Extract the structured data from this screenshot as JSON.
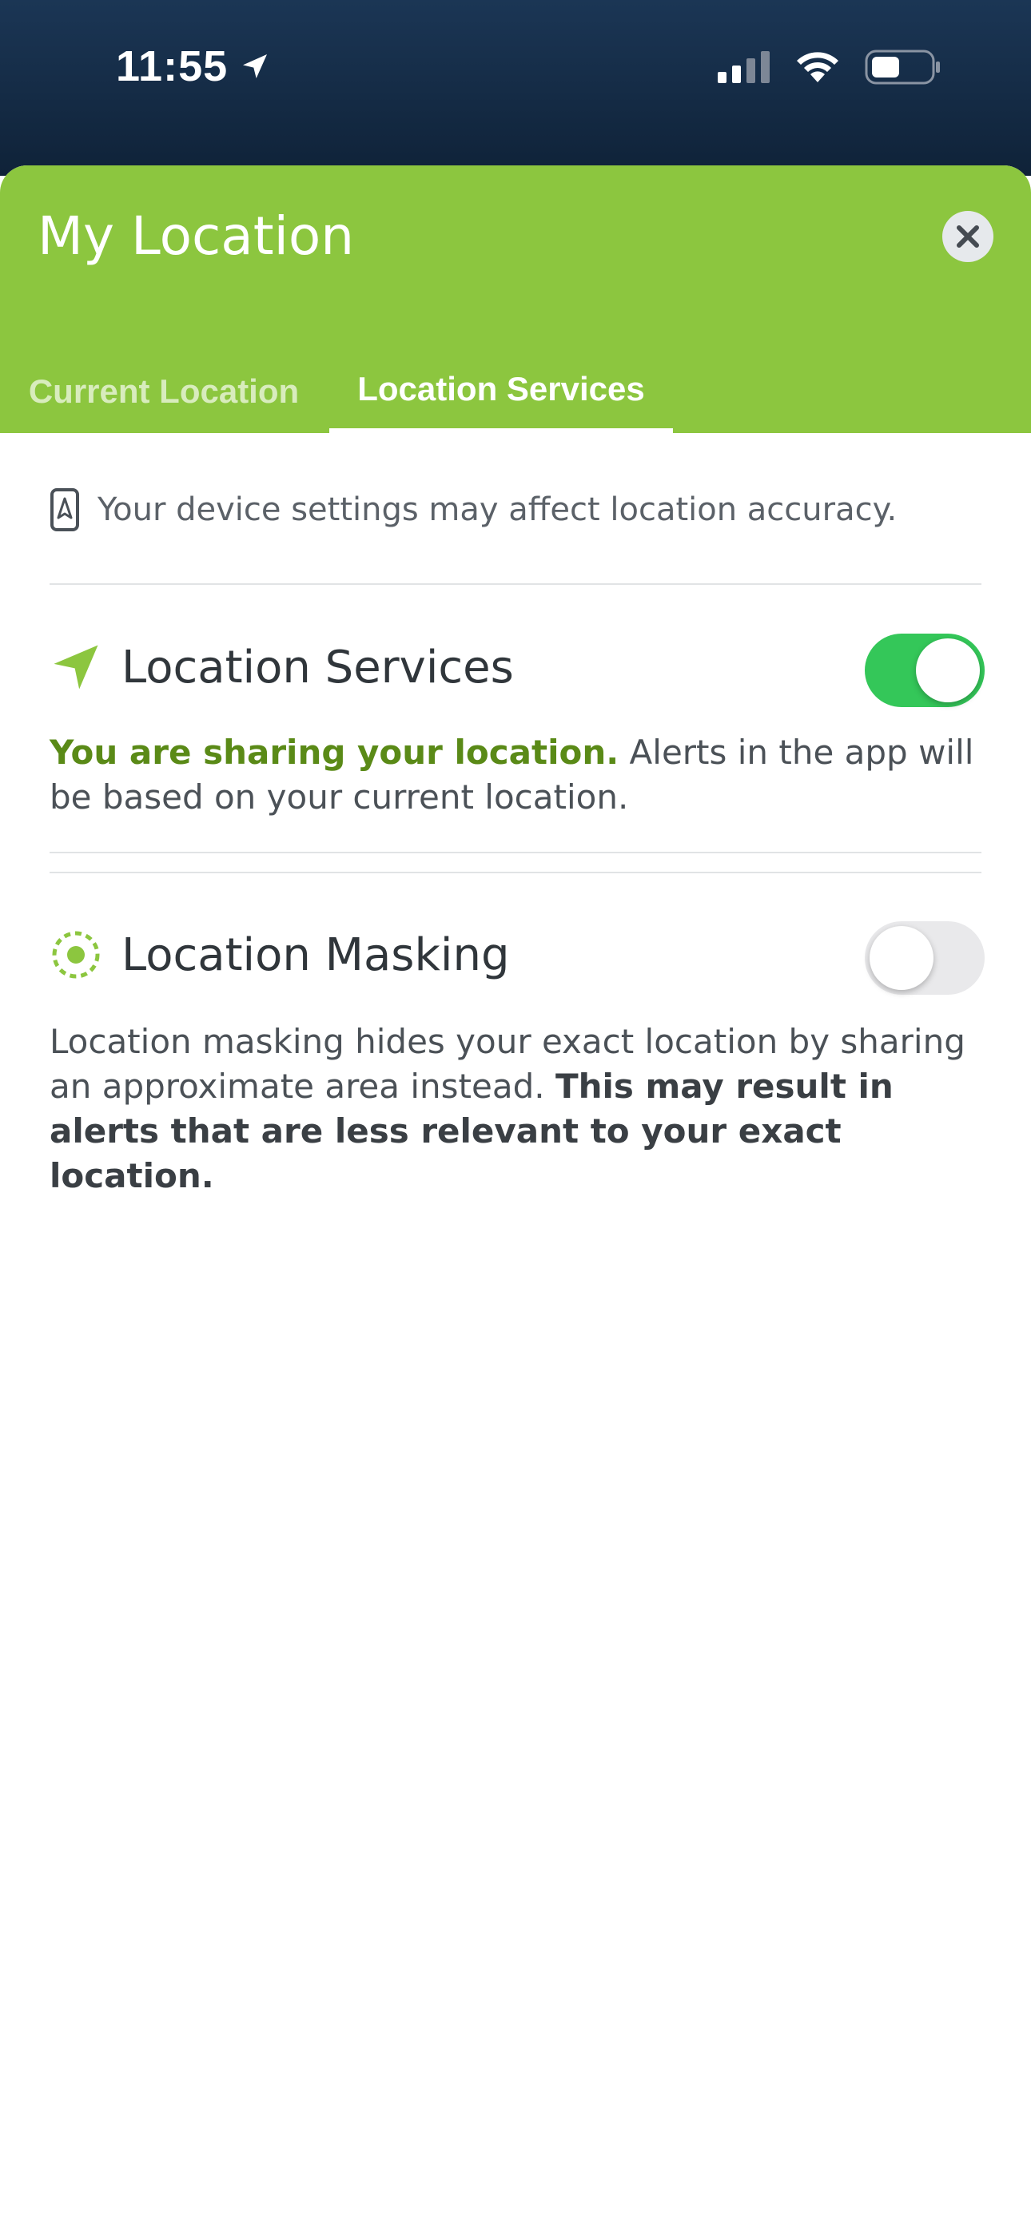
{
  "status_bar": {
    "time": "11:55",
    "icons": [
      "location-arrow-icon",
      "cellular-signal-icon",
      "wifi-icon",
      "battery-icon"
    ]
  },
  "sheet": {
    "title": "My Location",
    "close_icon": "close-icon",
    "tabs": [
      {
        "label": "Current Location",
        "active": false
      },
      {
        "label": "Location Services",
        "active": true
      }
    ]
  },
  "device_note": {
    "icon": "device-location-icon",
    "text": "Your device settings may affect location accuracy."
  },
  "location_services": {
    "icon": "navigation-arrow-icon",
    "title": "Location Services",
    "enabled": true,
    "desc_strong": "You are sharing your location.",
    "desc_rest": " Alerts in the app will be based on your current location."
  },
  "location_masking": {
    "icon": "masking-target-icon",
    "title": "Location Masking",
    "enabled": false,
    "desc_rest": "Location masking hides your exact location by sharing an approximate area instead. ",
    "desc_strong": "This may result in alerts that are less relevant to your exact location."
  },
  "colors": {
    "header_green": "#8cc63f",
    "status_bar_navy": "#1b3655",
    "toggle_on": "#34c759",
    "toggle_off": "#e9e9eb",
    "accent_green_text": "#5a8a17"
  }
}
